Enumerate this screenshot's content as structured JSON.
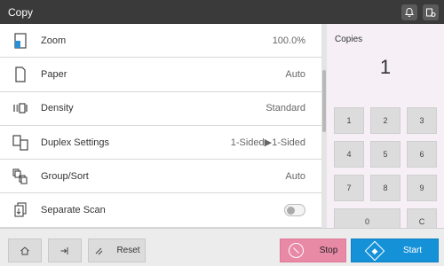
{
  "app": {
    "title": "Copy"
  },
  "settings": [
    {
      "icon": "zoom-icon",
      "label": "Zoom",
      "value": "100.0%"
    },
    {
      "icon": "paper-icon",
      "label": "Paper",
      "value": "Auto"
    },
    {
      "icon": "density-icon",
      "label": "Density",
      "value": "Standard"
    },
    {
      "icon": "duplex-icon",
      "label": "Duplex Settings",
      "value": "1-Sided▶1-Sided"
    },
    {
      "icon": "group-sort-icon",
      "label": "Group/Sort",
      "value": "Auto"
    },
    {
      "icon": "separate-scan-icon",
      "label": "Separate Scan",
      "toggle": false
    }
  ],
  "copies": {
    "caption": "Copies",
    "count": "1",
    "keys": [
      "1",
      "2",
      "3",
      "4",
      "5",
      "6",
      "7",
      "8",
      "9",
      "0",
      "C"
    ]
  },
  "bottom": {
    "reset": "Reset",
    "stop": "Stop",
    "start": "Start"
  },
  "colors": {
    "stop": "#e889a5",
    "start": "#1591d8",
    "titlebar": "#3a3a3a"
  }
}
